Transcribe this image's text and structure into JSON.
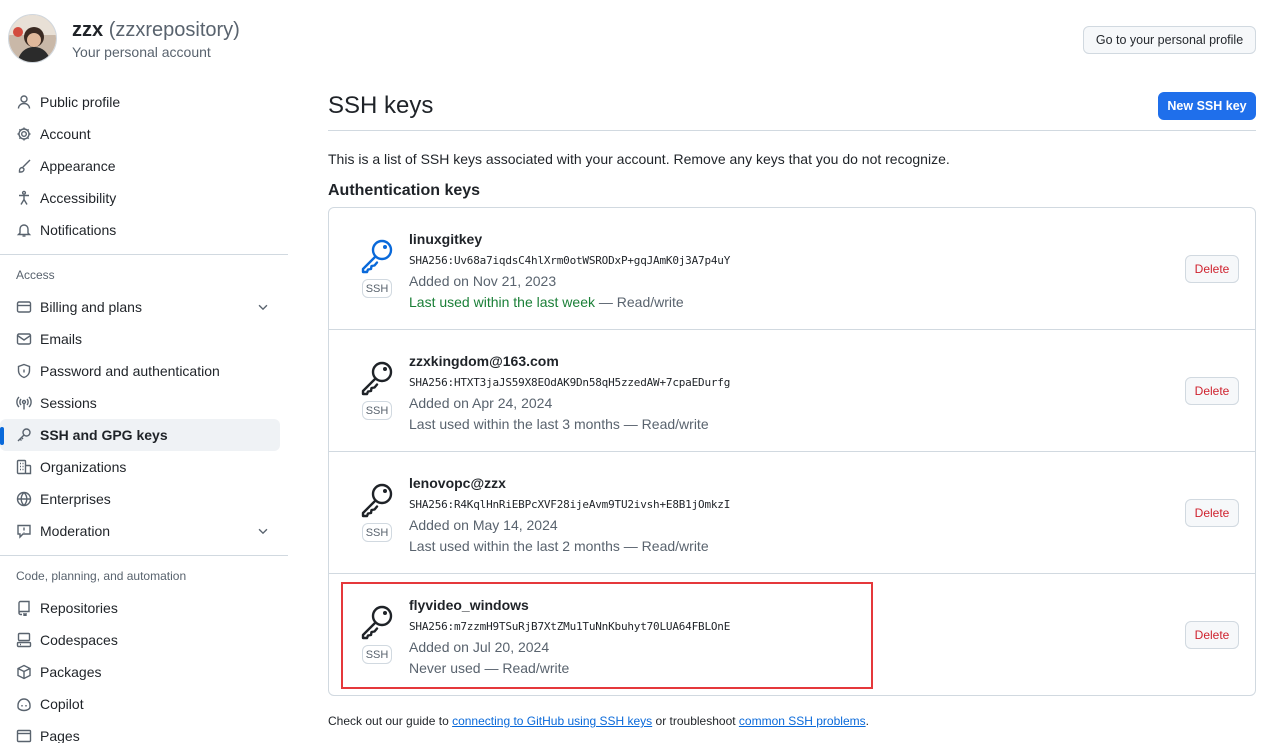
{
  "account": {
    "name": "zzx",
    "handle": "(zzxrepository)",
    "subtitle": "Your personal account",
    "profile_button": "Go to your personal profile"
  },
  "sidebar": {
    "items_top": [
      {
        "label": "Public profile",
        "icon": "person-icon"
      },
      {
        "label": "Account",
        "icon": "gear-icon"
      },
      {
        "label": "Appearance",
        "icon": "paintbrush-icon"
      },
      {
        "label": "Accessibility",
        "icon": "accessibility-icon"
      },
      {
        "label": "Notifications",
        "icon": "bell-icon"
      }
    ],
    "group_access": "Access",
    "items_access": [
      {
        "label": "Billing and plans",
        "icon": "credit-card-icon"
      },
      {
        "label": "Emails",
        "icon": "mail-icon"
      },
      {
        "label": "Password and authentication",
        "icon": "shield-lock-icon"
      },
      {
        "label": "Sessions",
        "icon": "broadcast-icon"
      },
      {
        "label": "SSH and GPG keys",
        "icon": "key-icon"
      },
      {
        "label": "Organizations",
        "icon": "organization-icon"
      },
      {
        "label": "Enterprises",
        "icon": "globe-icon"
      },
      {
        "label": "Moderation",
        "icon": "report-icon"
      }
    ],
    "group_code": "Code, planning, and automation",
    "items_code": [
      {
        "label": "Repositories",
        "icon": "repo-icon"
      },
      {
        "label": "Codespaces",
        "icon": "codespaces-icon"
      },
      {
        "label": "Packages",
        "icon": "package-icon"
      },
      {
        "label": "Copilot",
        "icon": "copilot-icon"
      },
      {
        "label": "Pages",
        "icon": "browser-icon"
      }
    ]
  },
  "main": {
    "title": "SSH keys",
    "new_button": "New SSH key",
    "description": "This is a list of SSH keys associated with your account. Remove any keys that you do not recognize.",
    "section_title": "Authentication keys",
    "keys": [
      {
        "title": "linuxgitkey",
        "fingerprint": "SHA256:Uv68a7iqdsC4hlXrm0otWSRODxP+gqJAmK0j3A7p4uY",
        "added": "Added on Nov 21, 2023",
        "used_prefix": "Last used within the last week",
        "used_suffix": " — Read/write",
        "recent": true,
        "badge": "SSH",
        "delete": "Delete"
      },
      {
        "title": "zzxkingdom@163.com",
        "fingerprint": "SHA256:HTXT3jaJS59X8EOdAK9Dn58qH5zzedAW+7cpaEDurfg",
        "added": "Added on Apr 24, 2024",
        "used_prefix": "Last used within the last 3 months",
        "used_suffix": " — Read/write",
        "recent": false,
        "badge": "SSH",
        "delete": "Delete"
      },
      {
        "title": "lenovopc@zzx",
        "fingerprint": "SHA256:R4KqlHnRiEBPcXVF28ijeAvm9TU2ivsh+E8B1jOmkzI",
        "added": "Added on May 14, 2024",
        "used_prefix": "Last used within the last 2 months",
        "used_suffix": " — Read/write",
        "recent": false,
        "badge": "SSH",
        "delete": "Delete"
      },
      {
        "title": "flyvideo_windows",
        "fingerprint": "SHA256:m7zzmH9TSuRjB7XtZMu1TuNnKbuhyt70LUA64FBLOnE",
        "added": "Added on Jul 20, 2024",
        "used_prefix": "Never used",
        "used_suffix": " — Read/write",
        "recent": false,
        "badge": "SSH",
        "delete": "Delete"
      }
    ],
    "footer": {
      "pre": "Check out our guide to ",
      "link1": "connecting to GitHub using SSH keys",
      "mid": " or troubleshoot ",
      "link2": "common SSH problems",
      "post": "."
    }
  },
  "colors": {
    "accent": "#1f6feb",
    "link": "#0969da",
    "danger": "#cf222e",
    "recent_used": "#1a7f37",
    "highlight_box": "#e5383b"
  }
}
